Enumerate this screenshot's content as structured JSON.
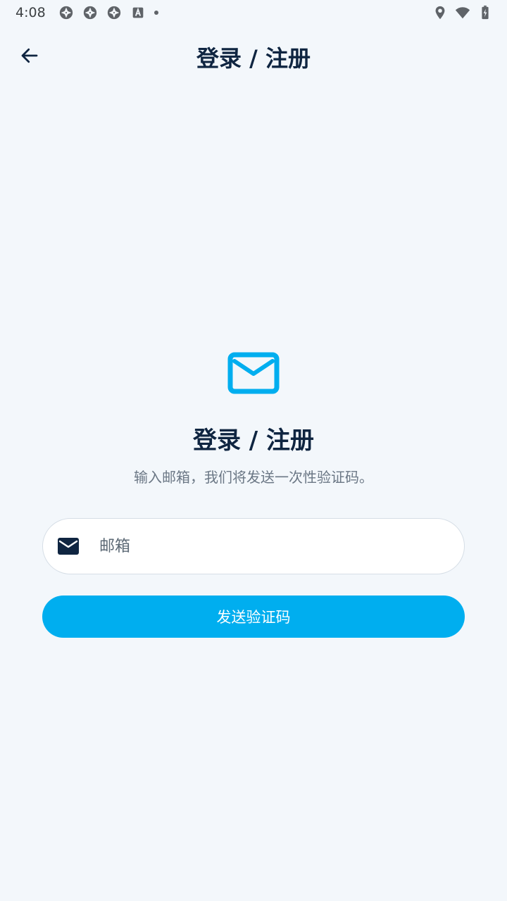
{
  "status_bar": {
    "time": "4:08",
    "icons": [
      "aperture-icon",
      "aperture-icon",
      "aperture-icon",
      "keyboard-a-icon",
      "dot-icon",
      "location-icon",
      "wifi-icon",
      "battery-charging-icon"
    ]
  },
  "app_bar": {
    "title": "登录 / 注册",
    "back_icon": "arrow-left-icon"
  },
  "main": {
    "icon": "mail-icon",
    "heading": "登录 / 注册",
    "subtitle": "输入邮箱，我们将发送一次性验证码。",
    "email_field": {
      "icon": "mail-icon",
      "value": "",
      "placeholder": "邮箱"
    },
    "send_button_label": "发送验证码"
  },
  "colors": {
    "background": "#F3F7FB",
    "primary": "#00AEEF",
    "title_text": "#0F2541",
    "muted_text": "#6B7785",
    "field_border": "#D6DEE6"
  }
}
